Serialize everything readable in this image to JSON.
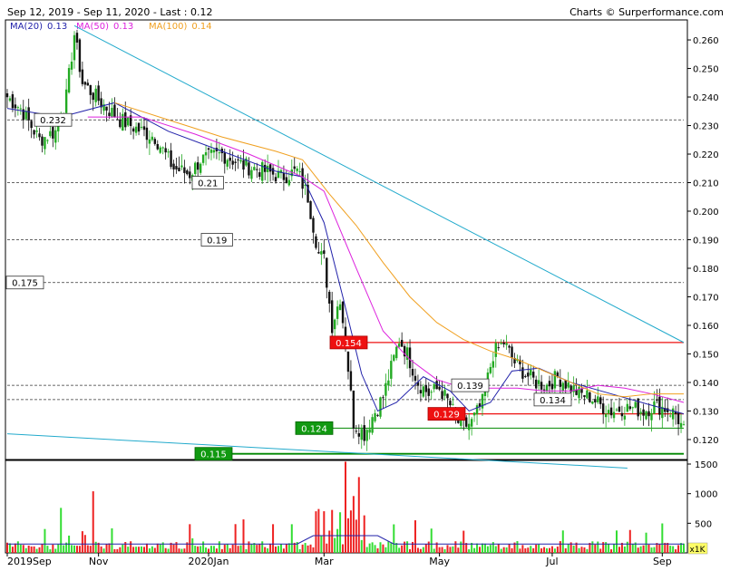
{
  "header": {
    "range": "Sep 12, 2019 - Sep 11, 2020 - Last : 0.12",
    "credit": "Charts © Surperformance.com"
  },
  "legend": [
    {
      "text": "MA(20)",
      "value": "0.13",
      "color": "#2222aa"
    },
    {
      "text": "MA(50)",
      "value": "0.13",
      "color": "#dd22dd"
    },
    {
      "text": "MA(100)",
      "value": "0.14",
      "color": "#f0a020"
    }
  ],
  "colors": {
    "up": "#22aa22",
    "down": "#111111",
    "volume_up": "#33dd33",
    "volume_down": "#ee2222",
    "ma20": "#2222aa",
    "ma50": "#dd22dd",
    "ma100": "#f0a020",
    "trendline": "#22aacc",
    "resistance": "#ee1111",
    "support": "#008800",
    "dashed": "#333333"
  },
  "chart_data": {
    "type": "candlestick",
    "price_ylim": [
      0.113,
      0.267
    ],
    "price_ticks": [
      "0.260",
      "0.250",
      "0.240",
      "0.230",
      "0.220",
      "0.210",
      "0.200",
      "0.190",
      "0.180",
      "0.170",
      "0.160",
      "0.150",
      "0.140",
      "0.130",
      "0.120"
    ],
    "volume_ticks": [
      "1500",
      "1000",
      "500"
    ],
    "volume_unit": "x1K",
    "volume_max": 1500,
    "x_ticks": [
      "2019Sep",
      "Nov",
      "2020Jan",
      "Mar",
      "May",
      "Jul",
      "Sep"
    ],
    "dashed_levels": [
      {
        "value": 0.232,
        "label": "0.232"
      },
      {
        "value": 0.21,
        "label": "0.21"
      },
      {
        "value": 0.19,
        "label": "0.19"
      },
      {
        "value": 0.175,
        "label": "0.175"
      },
      {
        "value": 0.139,
        "label": "0.139"
      },
      {
        "value": 0.134,
        "label": "0.134"
      }
    ],
    "red_levels": [
      {
        "value": 0.154,
        "label": "0.154"
      },
      {
        "value": 0.129,
        "label": "0.129"
      }
    ],
    "green_levels": [
      {
        "value": 0.124,
        "label": "0.124"
      },
      {
        "value": 0.115,
        "label": "0.115"
      }
    ],
    "price_anchors": [
      [
        0,
        0.24
      ],
      [
        5,
        0.236
      ],
      [
        12,
        0.225
      ],
      [
        18,
        0.228
      ],
      [
        22,
        0.24
      ],
      [
        25,
        0.262
      ],
      [
        28,
        0.245
      ],
      [
        35,
        0.238
      ],
      [
        42,
        0.232
      ],
      [
        50,
        0.228
      ],
      [
        55,
        0.226
      ],
      [
        62,
        0.215
      ],
      [
        68,
        0.213
      ],
      [
        72,
        0.218
      ],
      [
        80,
        0.22
      ],
      [
        88,
        0.216
      ],
      [
        96,
        0.214
      ],
      [
        102,
        0.212
      ],
      [
        108,
        0.214
      ],
      [
        112,
        0.205
      ],
      [
        116,
        0.185
      ],
      [
        118,
        0.183
      ],
      [
        121,
        0.16
      ],
      [
        124,
        0.17
      ],
      [
        127,
        0.145
      ],
      [
        129,
        0.126
      ],
      [
        131,
        0.124
      ],
      [
        133,
        0.122
      ],
      [
        136,
        0.128
      ],
      [
        140,
        0.135
      ],
      [
        143,
        0.145
      ],
      [
        146,
        0.155
      ],
      [
        149,
        0.15
      ],
      [
        153,
        0.14
      ],
      [
        157,
        0.136
      ],
      [
        161,
        0.138
      ],
      [
        165,
        0.132
      ],
      [
        169,
        0.124
      ],
      [
        173,
        0.126
      ],
      [
        177,
        0.133
      ],
      [
        181,
        0.15
      ],
      [
        185,
        0.154
      ],
      [
        189,
        0.147
      ],
      [
        193,
        0.143
      ],
      [
        197,
        0.14
      ],
      [
        201,
        0.139
      ],
      [
        205,
        0.142
      ],
      [
        209,
        0.139
      ],
      [
        213,
        0.136
      ],
      [
        217,
        0.135
      ],
      [
        221,
        0.132
      ],
      [
        225,
        0.13
      ],
      [
        229,
        0.131
      ],
      [
        233,
        0.131
      ],
      [
        237,
        0.13
      ],
      [
        241,
        0.132
      ],
      [
        245,
        0.131
      ],
      [
        249,
        0.129
      ],
      [
        252,
        0.123
      ]
    ],
    "ma20": [
      [
        0,
        0.236
      ],
      [
        20,
        0.233
      ],
      [
        40,
        0.238
      ],
      [
        60,
        0.228
      ],
      [
        80,
        0.221
      ],
      [
        100,
        0.214
      ],
      [
        110,
        0.212
      ],
      [
        118,
        0.196
      ],
      [
        125,
        0.17
      ],
      [
        132,
        0.143
      ],
      [
        138,
        0.13
      ],
      [
        145,
        0.133
      ],
      [
        155,
        0.142
      ],
      [
        165,
        0.137
      ],
      [
        172,
        0.13
      ],
      [
        180,
        0.133
      ],
      [
        188,
        0.144
      ],
      [
        198,
        0.145
      ],
      [
        210,
        0.14
      ],
      [
        225,
        0.136
      ],
      [
        240,
        0.132
      ],
      [
        252,
        0.129
      ]
    ],
    "ma50": [
      [
        30,
        0.233
      ],
      [
        50,
        0.233
      ],
      [
        70,
        0.227
      ],
      [
        90,
        0.22
      ],
      [
        110,
        0.212
      ],
      [
        118,
        0.207
      ],
      [
        130,
        0.18
      ],
      [
        140,
        0.158
      ],
      [
        150,
        0.148
      ],
      [
        160,
        0.141
      ],
      [
        170,
        0.138
      ],
      [
        180,
        0.138
      ],
      [
        190,
        0.138
      ],
      [
        200,
        0.137
      ],
      [
        210,
        0.137
      ],
      [
        220,
        0.139
      ],
      [
        230,
        0.138
      ],
      [
        240,
        0.136
      ],
      [
        252,
        0.133
      ]
    ],
    "ma100": [
      [
        40,
        0.238
      ],
      [
        60,
        0.232
      ],
      [
        80,
        0.226
      ],
      [
        100,
        0.221
      ],
      [
        110,
        0.218
      ],
      [
        120,
        0.206
      ],
      [
        130,
        0.195
      ],
      [
        140,
        0.182
      ],
      [
        150,
        0.17
      ],
      [
        160,
        0.161
      ],
      [
        170,
        0.155
      ],
      [
        180,
        0.151
      ],
      [
        190,
        0.148
      ],
      [
        200,
        0.144
      ],
      [
        210,
        0.14
      ],
      [
        220,
        0.136
      ],
      [
        230,
        0.135
      ],
      [
        240,
        0.136
      ],
      [
        252,
        0.136
      ]
    ],
    "trend_upper": [
      [
        25,
        0.265
      ],
      [
        252,
        0.154
      ]
    ],
    "trend_lower": [
      [
        0,
        0.122
      ],
      [
        231,
        0.11
      ]
    ]
  }
}
